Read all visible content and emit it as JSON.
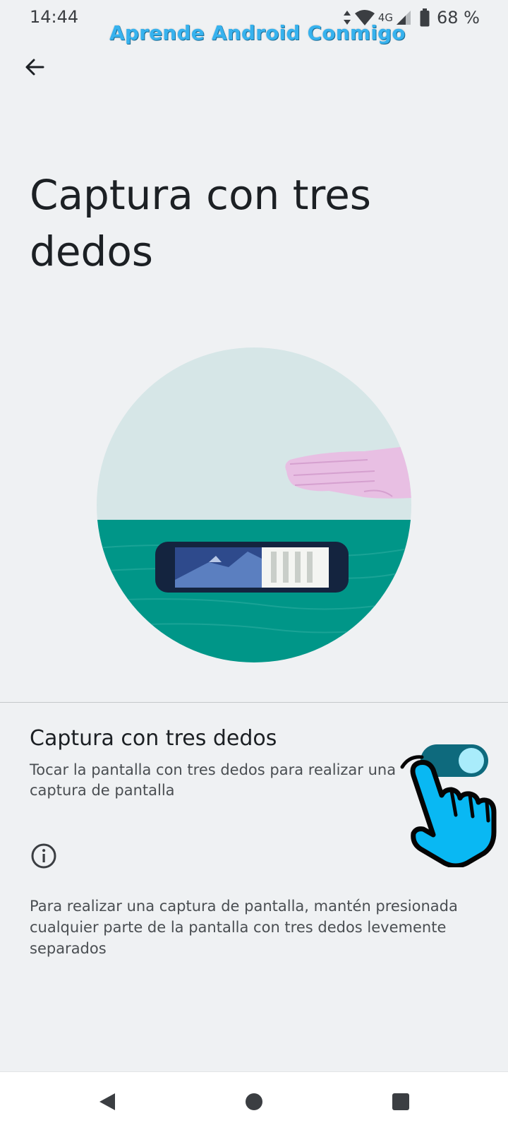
{
  "status_bar": {
    "time": "14:44",
    "network": "4G",
    "battery": "68 %"
  },
  "watermark": "Aprende Android Conmigo",
  "page": {
    "title": "Captura con tres dedos"
  },
  "setting": {
    "title": "Captura con tres dedos",
    "summary": "Tocar la pantalla con tres dedos para realizar una captura de pantalla",
    "enabled": true
  },
  "info": {
    "text": "Para realizar una captura de pantalla, mantén presionada cualquier parte de la pantalla con tres dedos levemente separados"
  },
  "icons": {
    "back": "arrow-back-icon",
    "info": "info-icon",
    "nav_back": "triangle-back-icon",
    "nav_home": "circle-home-icon",
    "nav_recents": "square-recents-icon"
  },
  "colors": {
    "background": "#eff1f3",
    "toggle_track": "#0e6a7d",
    "toggle_thumb": "#a9ecfb",
    "watermark": "#37b2ee",
    "sky": "#d6e6e7",
    "table": "#009688"
  }
}
